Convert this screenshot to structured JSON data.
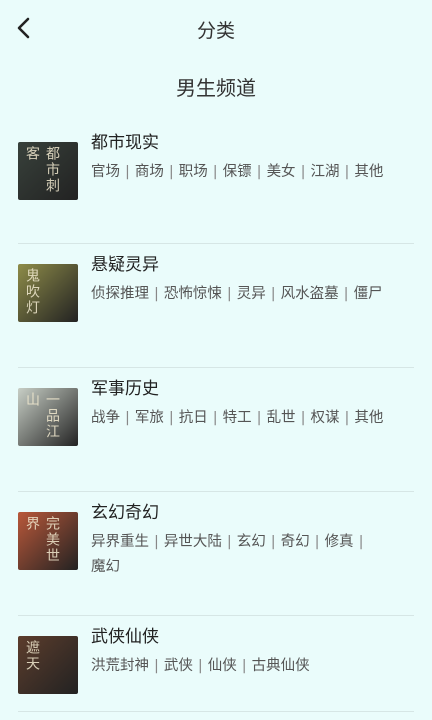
{
  "header": {
    "title": "分类",
    "back_icon": "chevron-left-icon"
  },
  "section": {
    "title": "男生频道"
  },
  "separator": "|",
  "categories": [
    {
      "name": "都市现实",
      "cover_text": "都市刺客",
      "cover_color": "#38413b",
      "tags": [
        "官场",
        "商场",
        "职场",
        "保镖",
        "美女",
        "江湖",
        "其他"
      ]
    },
    {
      "name": "悬疑灵异",
      "cover_text": "鬼吹灯",
      "cover_color": "#8e8c49",
      "tags": [
        "侦探推理",
        "恐怖惊悚",
        "灵异",
        "风水盗墓",
        "僵尸"
      ]
    },
    {
      "name": "军事历史",
      "cover_text": "一品江山",
      "cover_color": "#c8cfc6",
      "tags": [
        "战争",
        "军旅",
        "抗日",
        "特工",
        "乱世",
        "权谋",
        "其他"
      ]
    },
    {
      "name": "玄幻奇幻",
      "cover_text": "完美世界",
      "cover_color": "#b9583a",
      "tags": [
        "异界重生",
        "异世大陆",
        "玄幻",
        "奇幻",
        "修真",
        "魔幻"
      ]
    },
    {
      "name": "武侠仙侠",
      "cover_text": "遮天",
      "cover_color": "#5c3d2c",
      "tags": [
        "洪荒封神",
        "武侠",
        "仙侠",
        "古典仙侠"
      ]
    }
  ]
}
